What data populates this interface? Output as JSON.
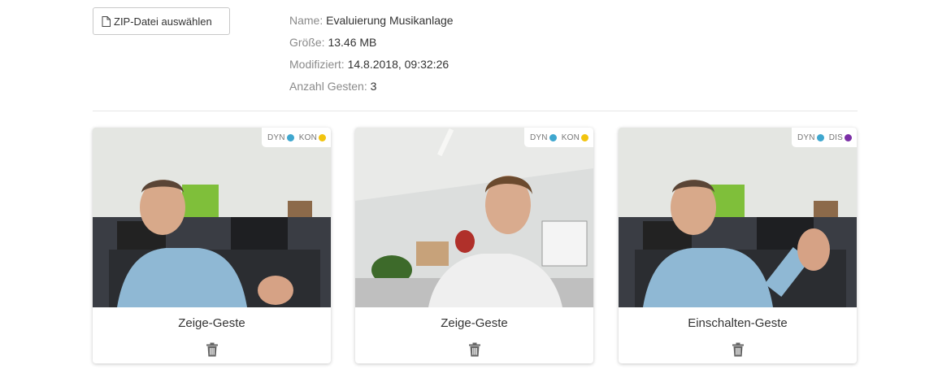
{
  "upload": {
    "button_label": "ZIP-Datei auswählen",
    "icon": "file-icon"
  },
  "meta": {
    "name_label": "Name:",
    "name_value": "Evaluierung Musikanlage",
    "size_label": "Größe:",
    "size_value": "13.46 MB",
    "modified_label": "Modifiziert:",
    "modified_value": "14.8.2018, 09:32:26",
    "count_label": "Anzahl Gesten:",
    "count_value": "3"
  },
  "colors": {
    "dyn": "#3fa7cf",
    "kon": "#f2c40f",
    "dis": "#7b2fa6"
  },
  "gestures": [
    {
      "title": "Zeige-Geste",
      "badges": [
        {
          "label": "DYN",
          "color": "#3fa7cf"
        },
        {
          "label": "KON",
          "color": "#f2c40f"
        }
      ],
      "thumbnail": "man-in-blue-shirt-pointing",
      "delete_icon": "trash-icon"
    },
    {
      "title": "Zeige-Geste",
      "badges": [
        {
          "label": "DYN",
          "color": "#3fa7cf"
        },
        {
          "label": "KON",
          "color": "#f2c40f"
        }
      ],
      "thumbnail": "man-in-white-shirt-office",
      "delete_icon": "trash-icon"
    },
    {
      "title": "Einschalten-Geste",
      "badges": [
        {
          "label": "DYN",
          "color": "#3fa7cf"
        },
        {
          "label": "DIS",
          "color": "#7b2fa6"
        }
      ],
      "thumbnail": "man-in-blue-shirt-raised-hand",
      "delete_icon": "trash-icon"
    }
  ]
}
